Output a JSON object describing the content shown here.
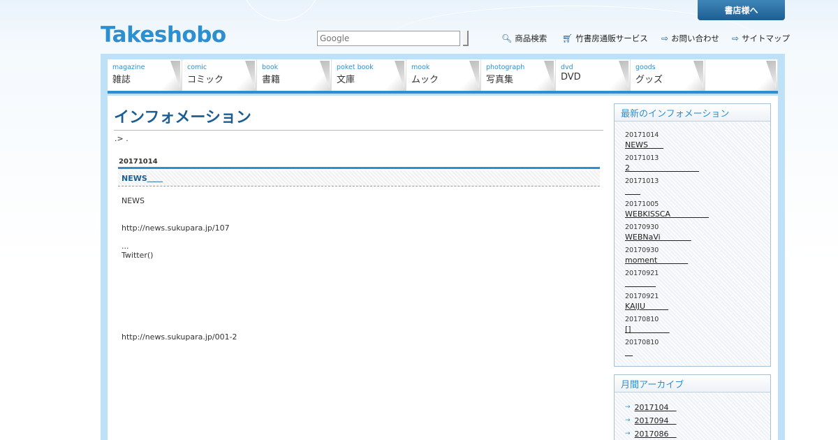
{
  "header": {
    "store_button": "書店様へ",
    "logo": "Takeshobo",
    "search_placeholder": "Google",
    "links": [
      {
        "label": "商品検索",
        "icon": "search-icon"
      },
      {
        "label": "竹書房通販サービス",
        "icon": "cart-icon"
      },
      {
        "label": "お問い合わせ",
        "icon": "arrow-box-icon"
      },
      {
        "label": "サイトマップ",
        "icon": "arrow-box-icon"
      }
    ]
  },
  "nav": [
    {
      "en": "magazine",
      "jp": "雑誌"
    },
    {
      "en": "comic",
      "jp": "コミック"
    },
    {
      "en": "book",
      "jp": "書籍"
    },
    {
      "en": "poket book",
      "jp": "文庫"
    },
    {
      "en": "mook",
      "jp": "ムック"
    },
    {
      "en": "photograph",
      "jp": "写真集"
    },
    {
      "en": "dvd",
      "jp": "DVD"
    },
    {
      "en": "goods",
      "jp": "グッズ"
    }
  ],
  "main": {
    "title": "インフォメーション",
    "breadcrumb": ".> .",
    "article": {
      "date": "20171014",
      "headline": "NEWS＿＿",
      "lines": [
        "NEWS",
        "http://news.sukupara.jp/107",
        "...",
        "Twitter()",
        "http://news.sukupara.jp/001-2"
      ]
    }
  },
  "sidebar": {
    "latest_title": "最新のインフォメーション",
    "latest": [
      {
        "date": "20171014",
        "title": "NEWS＿＿"
      },
      {
        "date": "20171013",
        "title": "2＿＿＿＿＿＿＿＿＿"
      },
      {
        "date": "20171013",
        "title": "＿＿"
      },
      {
        "date": "20171005",
        "title": "WEBKISSCA＿＿＿＿＿"
      },
      {
        "date": "20170930",
        "title": "WEBNaVi＿＿＿＿"
      },
      {
        "date": "20170930",
        "title": "moment＿＿＿＿"
      },
      {
        "date": "20170921",
        "title": "＿＿＿＿"
      },
      {
        "date": "20170921",
        "title": "KAIJU＿＿＿"
      },
      {
        "date": "20170810",
        "title": "[]＿＿＿＿＿"
      },
      {
        "date": "20170810",
        "title": "＿"
      }
    ],
    "archive_title": "月間アーカイブ",
    "archive": [
      "2017104＿",
      "2017094＿",
      "2017086＿"
    ]
  }
}
